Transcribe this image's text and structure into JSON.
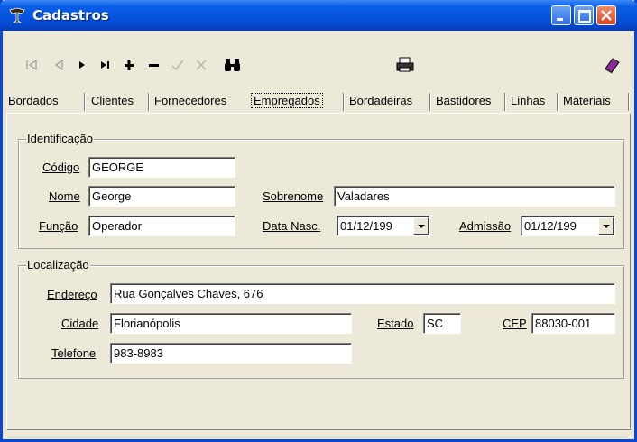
{
  "window": {
    "title": "Cadastros",
    "title_bar_color": "#0a47d6",
    "face_color": "#ece9d8"
  },
  "toolbar": {
    "buttons": [
      {
        "icon": "first-record-icon",
        "enabled": false
      },
      {
        "icon": "prior-record-icon",
        "enabled": false
      },
      {
        "icon": "next-record-icon",
        "enabled": true
      },
      {
        "icon": "last-record-icon",
        "enabled": true
      },
      {
        "icon": "insert-record-icon",
        "enabled": true
      },
      {
        "icon": "delete-record-icon",
        "enabled": true
      },
      {
        "icon": "post-edit-icon",
        "enabled": false
      },
      {
        "icon": "cancel-edit-icon",
        "enabled": false
      },
      {
        "icon": "binoculars-search-icon",
        "enabled": true
      },
      {
        "icon": "printer-icon",
        "enabled": true
      },
      {
        "icon": "book-exit-icon",
        "enabled": true
      }
    ]
  },
  "tabs": [
    {
      "label": "Bordados",
      "active": false
    },
    {
      "label": "Clientes",
      "active": false
    },
    {
      "label": "Fornecedores",
      "active": false
    },
    {
      "label": "Empregados",
      "active": true
    },
    {
      "label": "Bordadeiras",
      "active": false
    },
    {
      "label": "Bastidores",
      "active": false
    },
    {
      "label": "Linhas",
      "active": false
    },
    {
      "label": "Materiais",
      "active": false
    }
  ],
  "identificacao": {
    "title": "Identificação",
    "codigo_label": "Código",
    "codigo_value": "GEORGE",
    "nome_label": "Nome",
    "nome_value": "George",
    "sobrenome_label": "Sobrenome",
    "sobrenome_value": "Valadares",
    "funcao_label": "Função",
    "funcao_value": "Operador",
    "data_nasc_label": "Data Nasc.",
    "data_nasc_value": "01/12/199",
    "admissao_label": "Admissão",
    "admissao_value": "01/12/199"
  },
  "localizacao": {
    "title": "Localização",
    "endereco_label": "Endereço",
    "endereco_value": "Rua Gonçalves Chaves, 676",
    "cidade_label": "Cidade",
    "cidade_value": "Florianópolis",
    "estado_label": "Estado",
    "estado_value": "SC",
    "cep_label": "CEP",
    "cep_value": "88030-001",
    "telefone_label": "Telefone",
    "telefone_value": "983-8983"
  }
}
